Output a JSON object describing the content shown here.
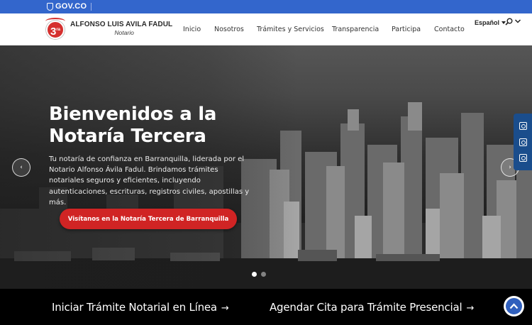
{
  "gov_bar": {
    "logo_text": "GOV.CO",
    "color": "#3366cc"
  },
  "header": {
    "brand_name": "ALFONSO LUIS AVILA FADUL",
    "brand_role": "Notario",
    "seal_text": "3",
    "seal_suffix": "ra",
    "nav": [
      "Inicio",
      "Nosotros",
      "Trámites y Servicios",
      "Transparencia",
      "Participa",
      "Contacto"
    ],
    "language": "Español",
    "icons": {
      "search": "search-icon",
      "menu": "chevron-down-icon"
    }
  },
  "hero": {
    "title": "Bienvenidos a la Notaría Tercera",
    "text": "Tu notaría de confianza en Barranquilla, liderada por el Notario Alfonso Ávila Fadul. Brindamos trámites notariales seguros y eficientes, incluyendo autenticaciones, escrituras, registros civiles, apostillas y más.",
    "button_label": "Visítanos en la Notaría Tercera de Barranquilla",
    "prev_label": "‹",
    "next_label": "›",
    "slides": 2,
    "active_slide": 1,
    "accent": "#d02424"
  },
  "social": {
    "icons": [
      "instagram-icon",
      "image-icon",
      "image-icon"
    ],
    "color": "#1a4d8c"
  },
  "bottom": {
    "cta_online": "Iniciar Trámite Notarial en Línea",
    "cta_appointment": "Agendar Cita para Trámite Presencial",
    "arrow": "→"
  }
}
